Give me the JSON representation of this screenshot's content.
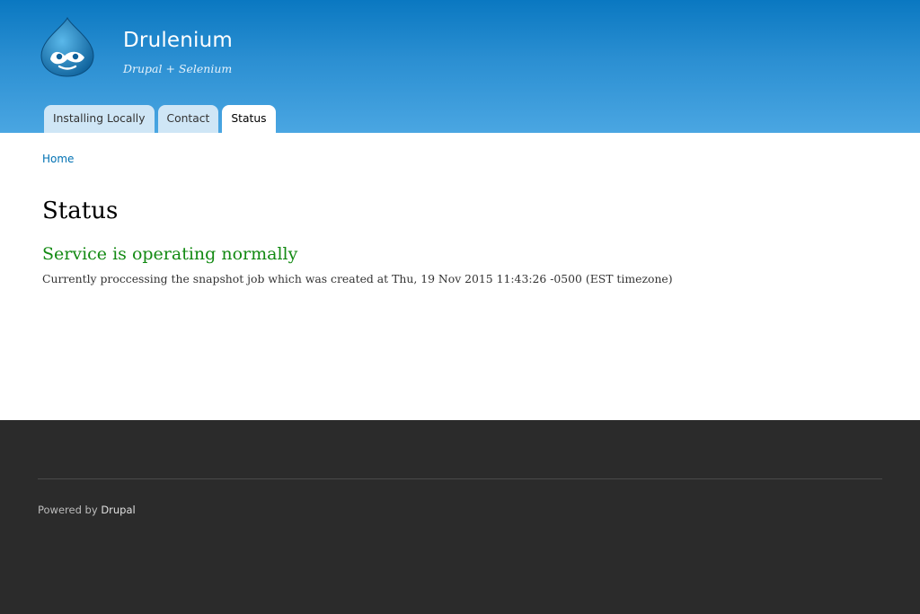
{
  "header": {
    "site_name": "Drulenium",
    "slogan": "Drupal + Selenium",
    "logo_icon": "drupal-drop-icon"
  },
  "nav": {
    "tabs": [
      {
        "label": "Installing Locally",
        "active": false
      },
      {
        "label": "Contact",
        "active": false
      },
      {
        "label": "Status",
        "active": true
      }
    ]
  },
  "main": {
    "breadcrumb": "Home",
    "title": "Status",
    "status_heading": "Service is operating normally",
    "status_text": "Currently proccessing the snapshot job which was created at Thu, 19 Nov 2015 11:43:26 -0500 (EST timezone)"
  },
  "footer": {
    "powered_by": "Powered by",
    "powered_link": "Drupal"
  },
  "colors": {
    "header_top": "#0a78c1",
    "header_bottom": "#4aa6e2",
    "status_green": "#138a13",
    "link_blue": "#0071b3",
    "footer_bg": "#2b2b2b"
  }
}
